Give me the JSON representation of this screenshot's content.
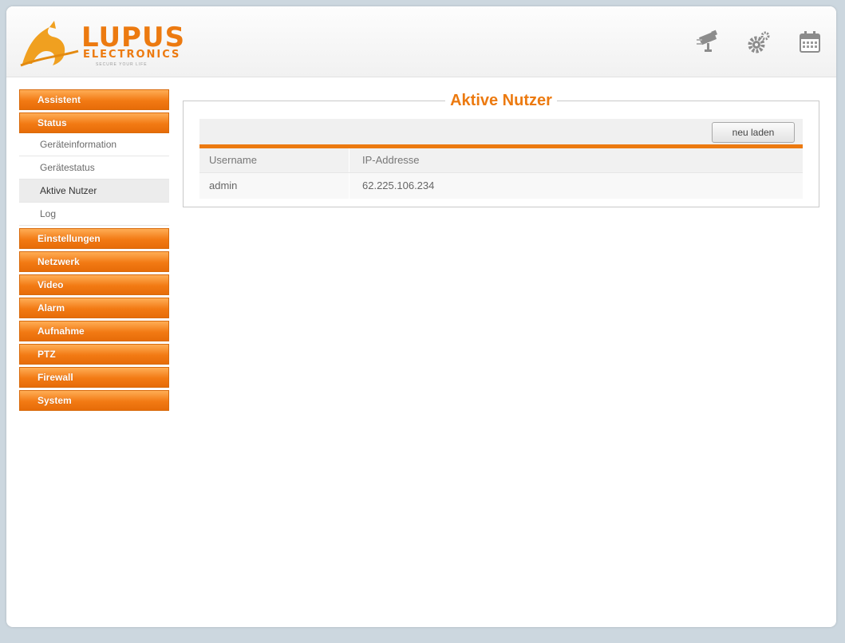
{
  "logo": {
    "name": "LUPUS",
    "subtitle": "ELECTRONICS",
    "tagline": "SECURE YOUR LIFE"
  },
  "header_icons": [
    {
      "icon": "camera-icon"
    },
    {
      "icon": "gears-icon"
    },
    {
      "icon": "calendar-icon"
    }
  ],
  "sidebar": {
    "assistent": "Assistent",
    "status": "Status",
    "status_sub": [
      "Geräteinformation",
      "Gerätestatus",
      "Aktive Nutzer",
      "Log"
    ],
    "active_sub_index": 2,
    "rest": [
      "Einstellungen",
      "Netzwerk",
      "Video",
      "Alarm",
      "Aufnahme",
      "PTZ",
      "Firewall",
      "System"
    ]
  },
  "panel": {
    "title": "Aktive Nutzer",
    "reload_label": "neu laden",
    "columns": [
      "Username",
      "IP-Addresse"
    ],
    "rows": [
      [
        "admin",
        "62.225.106.234"
      ]
    ]
  },
  "colors": {
    "accent": "#ec7a10",
    "background": "#ccd7df"
  }
}
